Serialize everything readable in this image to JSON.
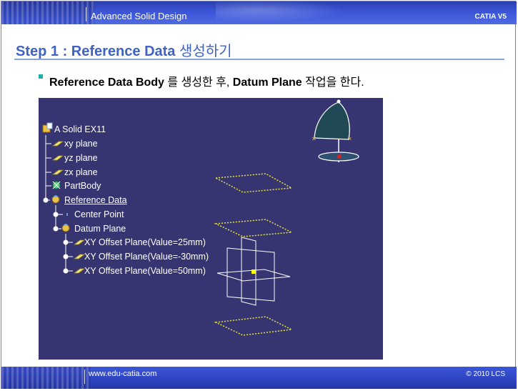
{
  "header": {
    "title": "Advanced Solid Design",
    "product": "CATIA V5"
  },
  "slide": {
    "title_en": "Step 1 : Reference Data ",
    "title_kr": "생성하기",
    "bullet_bold1": "Reference Data Body",
    "bullet_text1": " 를 생성한 후, ",
    "bullet_bold2": "Datum Plane",
    "bullet_text2": " 작업을 한다."
  },
  "tree": {
    "root": "A Solid EX11",
    "items": [
      {
        "label": "xy plane",
        "icon": "plane-icon"
      },
      {
        "label": "yz plane",
        "icon": "plane-icon"
      },
      {
        "label": "zx plane",
        "icon": "plane-icon"
      },
      {
        "label": "PartBody",
        "icon": "partbody-icon"
      },
      {
        "label": "Reference Data",
        "icon": "geometrical-set-icon"
      },
      {
        "label": "Center Point",
        "icon": "point-icon"
      },
      {
        "label": "Datum Plane",
        "icon": "geometrical-set-icon"
      },
      {
        "label": "XY Offset Plane(Value=25mm)",
        "icon": "plane-icon"
      },
      {
        "label": "XY Offset Plane(Value=-30mm)",
        "icon": "plane-icon"
      },
      {
        "label": "XY Offset Plane(Value=50mm)",
        "icon": "plane-icon"
      }
    ]
  },
  "footer": {
    "url": "www.edu-catia.com",
    "copyright": "© 2010 LCS"
  },
  "colors": {
    "header_blue": "#3b55d8",
    "title_blue": "#3f62c4",
    "viewport_bg": "#363572",
    "datum_plane_yellow": "#e8e23a",
    "bullet_teal": "#1fb0a8"
  }
}
